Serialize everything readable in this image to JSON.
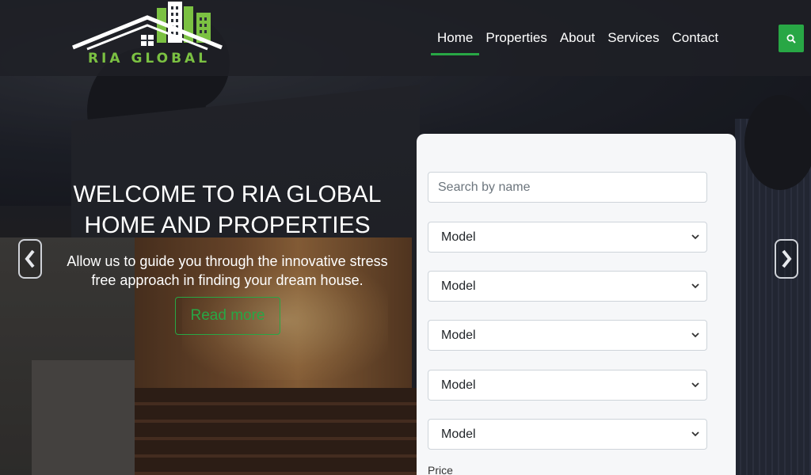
{
  "brand": {
    "name": "RIA GLOBAL",
    "accent": "#28a745",
    "logo_green": "#7bc142"
  },
  "nav": {
    "items": [
      {
        "label": "Home",
        "active": true
      },
      {
        "label": "Properties",
        "active": false
      },
      {
        "label": "About",
        "active": false
      },
      {
        "label": "Services",
        "active": false
      },
      {
        "label": "Contact",
        "active": false
      }
    ],
    "search_icon": "search-icon"
  },
  "hero": {
    "title_line1": "WELCOME TO RIA GLOBAL",
    "title_line2": "HOME AND PROPERTIES",
    "subtitle_line1": "Allow us to guide you through the innovative stress",
    "subtitle_line2": "free approach in finding your dream house.",
    "cta_label": "Read more",
    "prev_icon": "chevron-left-icon",
    "next_icon": "chevron-right-icon"
  },
  "search_panel": {
    "name_placeholder": "Search by name",
    "selects": [
      {
        "value": "Model"
      },
      {
        "value": "Model"
      },
      {
        "value": "Model"
      },
      {
        "value": "Model"
      },
      {
        "value": "Model"
      }
    ],
    "price_label": "Price"
  }
}
